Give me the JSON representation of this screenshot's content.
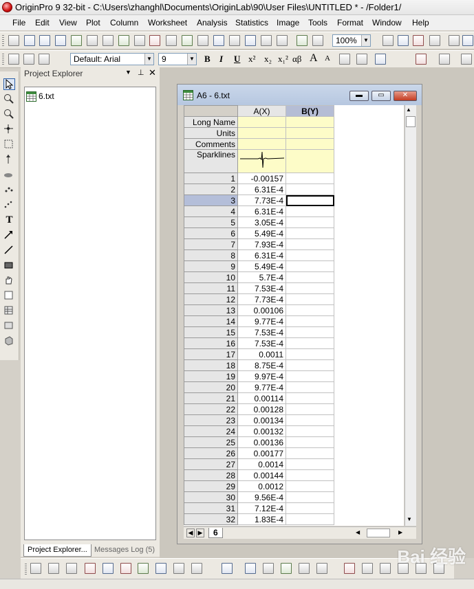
{
  "window": {
    "title": "OriginPro 9 32-bit - C:\\Users\\zhanghl\\Documents\\OriginLab\\90\\User Files\\UNTITLED * - /Folder1/"
  },
  "menu": [
    "File",
    "Edit",
    "View",
    "Plot",
    "Column",
    "Worksheet",
    "Analysis",
    "Statistics",
    "Image",
    "Tools",
    "Format",
    "Window",
    "Help"
  ],
  "toolbar": {
    "zoom": "100%",
    "font_name": "Default: Arial",
    "font_size": "9",
    "bold": "B",
    "italic": "I",
    "underline": "U",
    "superscript": "x²",
    "subscript": "x₂",
    "supersub": "x₁²",
    "greek": "αβ",
    "increase_font": "A",
    "decrease_font": "A"
  },
  "project_explorer": {
    "title": "Project Explorer",
    "items": [
      "6.txt"
    ],
    "tabs": [
      "Project Explorer...",
      "Messages Log (5)"
    ]
  },
  "worksheet": {
    "title": "A6 - 6.txt",
    "columns": [
      "A(X)",
      "B(Y)"
    ],
    "meta_rows": [
      "Long Name",
      "Units",
      "Comments",
      "Sparklines"
    ],
    "rows": [
      {
        "n": "1",
        "a": "-0.00157"
      },
      {
        "n": "2",
        "a": "6.31E-4"
      },
      {
        "n": "3",
        "a": "7.73E-4"
      },
      {
        "n": "4",
        "a": "6.31E-4"
      },
      {
        "n": "5",
        "a": "3.05E-4"
      },
      {
        "n": "6",
        "a": "5.49E-4"
      },
      {
        "n": "7",
        "a": "7.93E-4"
      },
      {
        "n": "8",
        "a": "6.31E-4"
      },
      {
        "n": "9",
        "a": "5.49E-4"
      },
      {
        "n": "10",
        "a": "5.7E-4"
      },
      {
        "n": "11",
        "a": "7.53E-4"
      },
      {
        "n": "12",
        "a": "7.73E-4"
      },
      {
        "n": "13",
        "a": "0.00106"
      },
      {
        "n": "14",
        "a": "9.77E-4"
      },
      {
        "n": "15",
        "a": "7.53E-4"
      },
      {
        "n": "16",
        "a": "7.53E-4"
      },
      {
        "n": "17",
        "a": "0.0011"
      },
      {
        "n": "18",
        "a": "8.75E-4"
      },
      {
        "n": "19",
        "a": "9.97E-4"
      },
      {
        "n": "20",
        "a": "9.77E-4"
      },
      {
        "n": "21",
        "a": "0.00114"
      },
      {
        "n": "22",
        "a": "0.00128"
      },
      {
        "n": "23",
        "a": "0.00134"
      },
      {
        "n": "24",
        "a": "0.00132"
      },
      {
        "n": "25",
        "a": "0.00136"
      },
      {
        "n": "26",
        "a": "0.00177"
      },
      {
        "n": "27",
        "a": "0.0014"
      },
      {
        "n": "28",
        "a": "0.00144"
      },
      {
        "n": "29",
        "a": "0.0012"
      },
      {
        "n": "30",
        "a": "9.56E-4"
      },
      {
        "n": "31",
        "a": "7.12E-4"
      },
      {
        "n": "32",
        "a": "1.83E-4"
      }
    ],
    "selected_row": "3",
    "sheet_tab": "6"
  },
  "watermark": "Bai 经验",
  "colors": {
    "meta_bg": "#fdfcc8",
    "selected_col": "#b5bdd5",
    "row_header": "#e6e6e6",
    "title_gradient": "#b6c7e0"
  }
}
